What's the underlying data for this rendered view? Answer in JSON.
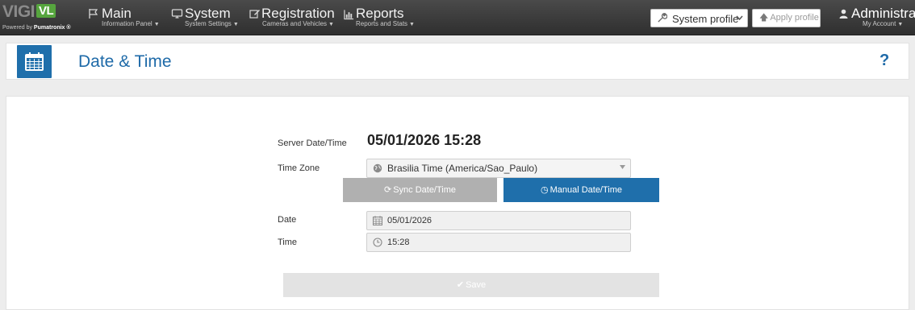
{
  "brand": {
    "logo_part1": "VIGI",
    "logo_part2": "VL",
    "powered_prefix": "Powered by ",
    "powered_brand": "Pumatronix ®"
  },
  "nav": {
    "main": {
      "label": "Main",
      "sub": "Information Panel",
      "icon": "flag-icon"
    },
    "system": {
      "label": "System",
      "sub": "System Settings",
      "icon": "monitor-icon"
    },
    "registration": {
      "label": "Registration",
      "sub": "Cameras and Vehicles",
      "icon": "edit-icon"
    },
    "reports": {
      "label": "Reports",
      "sub": "Reports and Stats",
      "icon": "bar-chart-icon"
    }
  },
  "profile_select": {
    "value": "System profile",
    "icon": "wrench-icon"
  },
  "apply_profile": {
    "label": "Apply profile",
    "icon": "arrow-up-icon"
  },
  "account": {
    "name": "Administrador",
    "sub": "My Account",
    "icon": "user-icon"
  },
  "page": {
    "title": "Date & Time",
    "icon": "calendar-icon",
    "help": "?"
  },
  "form": {
    "server_label": "Server Date/Time",
    "server_value": "05/01/2026 15:28",
    "timezone_label": "Time Zone",
    "timezone_value": "Brasilia Time (America/Sao_Paulo)",
    "sync_button": "Sync Date/Time",
    "manual_button": "Manual Date/Time",
    "date_label": "Date",
    "date_value": "05/01/2026",
    "time_label": "Time",
    "time_value": "15:28",
    "save_button": "Save"
  },
  "colors": {
    "primary": "#1f6fab",
    "brand_green": "#56a53e",
    "navbar": "#3a3a3a"
  }
}
